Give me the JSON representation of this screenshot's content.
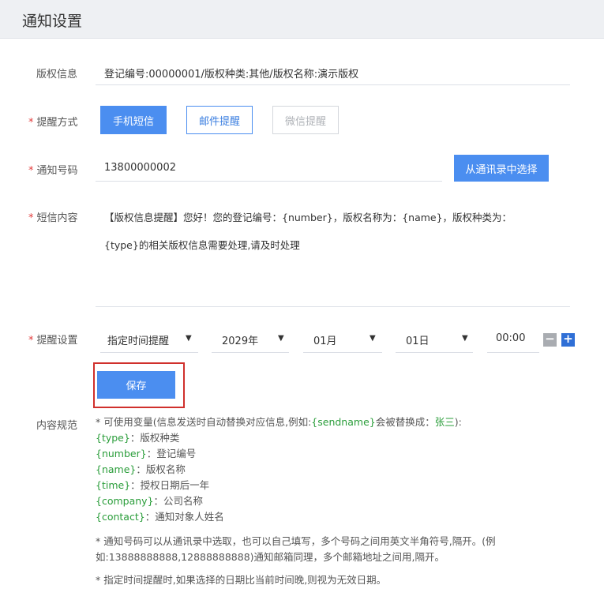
{
  "header": {
    "title": "通知设置"
  },
  "copyright": {
    "label": "版权信息",
    "value": "登记编号:00000001/版权种类:其他/版权名称:演示版权"
  },
  "remind_method": {
    "label": "提醒方式",
    "buttons": [
      "手机短信",
      "邮件提醒",
      "微信提醒"
    ]
  },
  "notify_number": {
    "label": "通知号码",
    "value": "13800000002",
    "pick_button": "从通讯录中选择"
  },
  "sms_content": {
    "label": "短信内容",
    "line1": "【版权信息提醒】您好！您的登记编号：{number}，版权名称为：{name}，版权种类为：",
    "line2": "{type}的相关版权信息需要处理,请及时处理"
  },
  "remind_setting": {
    "label": "提醒设置",
    "mode": "指定时间提醒",
    "year": "2029年",
    "month": "01月",
    "day": "01日",
    "time": "00:00",
    "minus": "−",
    "plus": "+"
  },
  "save_button": "保存",
  "content_rules": {
    "label": "内容规范",
    "intro_pre": "* 可使用变量(信息发送时自动替换对应信息,例如:",
    "intro_var": "{sendname}",
    "intro_mid": "会被替换成：",
    "intro_name": "张三",
    "intro_post": "):",
    "vars": [
      {
        "key": "{type}",
        "desc": "：版权种类"
      },
      {
        "key": "{number}",
        "desc": "：登记编号"
      },
      {
        "key": "{name}",
        "desc": "：版权名称"
      },
      {
        "key": "{time}",
        "desc": "：授权日期后一年"
      },
      {
        "key": "{company}",
        "desc": "：公司名称"
      },
      {
        "key": "{contact}",
        "desc": "：通知对象人姓名"
      }
    ],
    "note1": "* 通知号码可以从通讯录中选取，也可以自己填写，多个号码之间用英文半角符号,隔开。(例如:13888888888,12888888888)通知邮箱同理，多个邮箱地址之间用,隔开。",
    "note2": "* 指定时间提醒时,如果选择的日期比当前时间晚,则视为无效日期。"
  },
  "colors": {
    "primary": "#4b8ef0",
    "required": "#e23c3c",
    "highlight_border": "#d0302c",
    "variable_green": "#2a9d3a"
  }
}
